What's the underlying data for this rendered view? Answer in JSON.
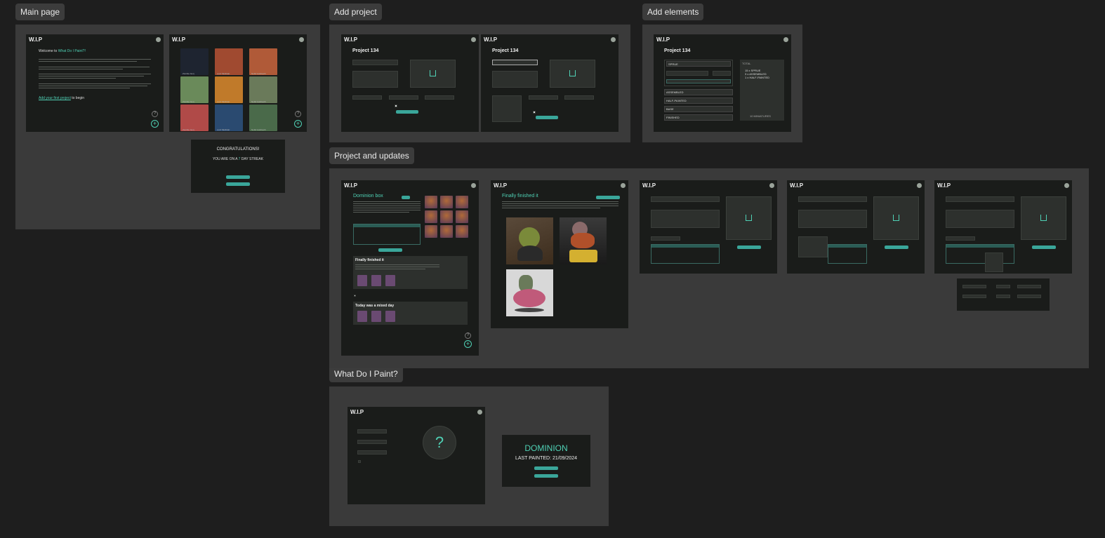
{
  "sections": {
    "main_page": "Main page",
    "add_project": "Add project",
    "add_elements": "Add elements",
    "project_updates": "Project and updates",
    "what_do_i_paint": "What Do I Paint?"
  },
  "app": {
    "logo": "W.I.P"
  },
  "welcome": {
    "greeting_prefix": "Welcome to ",
    "app_name": "What Do I Paint?!",
    "cta_link": "Add your first project",
    "cta_suffix": " to begin"
  },
  "gallery": {
    "captions": [
      "Zombie Gorj",
      "Lord Skullstar",
      "Nobil Goldtooth",
      "Zombie Gorj",
      "Lord Skullstar",
      "Nobil Goldtooth",
      "Zombie Gorj",
      "Lord Skullstar",
      "Nobil Goldtooth"
    ]
  },
  "streak": {
    "title": "CONGRATULATIONS!",
    "text_prefix": "YOU ARE ON A ",
    "days": "7",
    "text_suffix": " DAY STREAK"
  },
  "project": {
    "title": "Project 134"
  },
  "elements": {
    "sprue": "SPRUE",
    "assembled": "ASSEMBLED",
    "half_painted": "HALF-PAINTED",
    "base": "BASE",
    "finished": "FINISHED",
    "total_label": "TOTAL",
    "total_lines": [
      "15 x SPRUE",
      "3 x ASSEMBLED",
      "1 x HALF-PAINTED"
    ],
    "count": "10 MINIATURES"
  },
  "dominion": {
    "title": "Dominion box",
    "update1": "Finally finished it",
    "update2": "Today was a mixed day"
  },
  "finished_frame": {
    "title": "Finally finished it"
  },
  "wdip": {
    "question": "?",
    "result_title": "DOMINION",
    "result_sub": "LAST PAINTED: 21/09/2024"
  },
  "colors": {
    "accent": "#4fd1b5",
    "background": "#1e1e1e",
    "section": "#3a3a3a",
    "frame": "#1a1c1a"
  }
}
